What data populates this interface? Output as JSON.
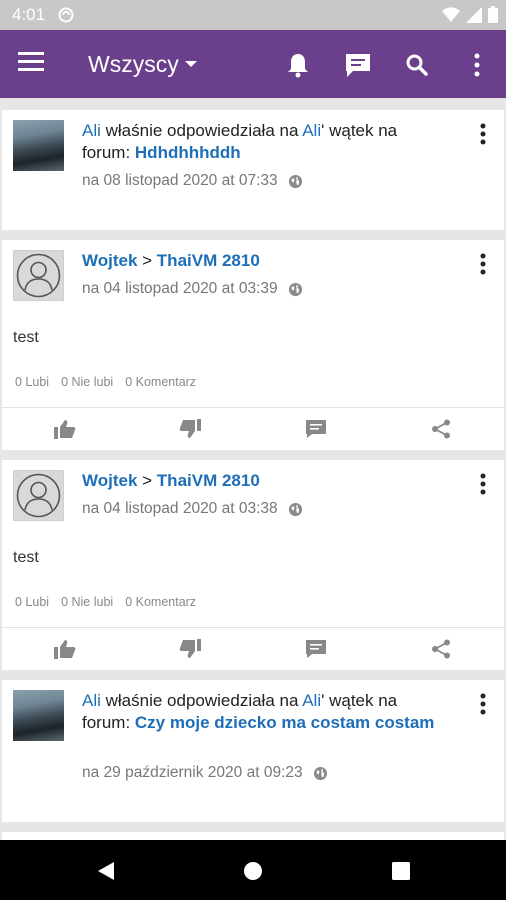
{
  "status_bar": {
    "time": "4:01"
  },
  "app_bar": {
    "filter_label": "Wszyscy"
  },
  "feed": {
    "card1": {
      "user": "Ali",
      "action_text": " właśnie odpowiedziała na ",
      "target_user": "Ali",
      "after_target": "' wątek na forum: ",
      "topic": "Hdhdhhhddh",
      "timestamp": "na 08 listopad 2020 at 07:33"
    },
    "card2": {
      "author": "Wojtek",
      "separator": " > ",
      "recipient": "ThaiVM 2810",
      "timestamp": "na 04 listopad 2020 at 03:39",
      "body": "test",
      "likes": "0 Lubi",
      "dislikes": "0 Nie lubi",
      "comments": "0 Komentarz"
    },
    "card3": {
      "author": "Wojtek",
      "separator": " > ",
      "recipient": "ThaiVM 2810",
      "timestamp": "na 04 listopad 2020 at 03:38",
      "body": "test",
      "likes": "0 Lubi",
      "dislikes": "0 Nie lubi",
      "comments": "0 Komentarz"
    },
    "card4": {
      "user": "Ali",
      "action_text": " właśnie odpowiedziała na ",
      "target_user": "Ali",
      "after_target": "' wątek na forum: ",
      "topic": "Czy moje dziecko ma costam costam",
      "timestamp": "na 29 październik 2020 at 09:23"
    }
  },
  "colors": {
    "app_bar": "#6a3f8c",
    "link": "#1e6fb8",
    "status_bar": "#c8c8c8"
  }
}
